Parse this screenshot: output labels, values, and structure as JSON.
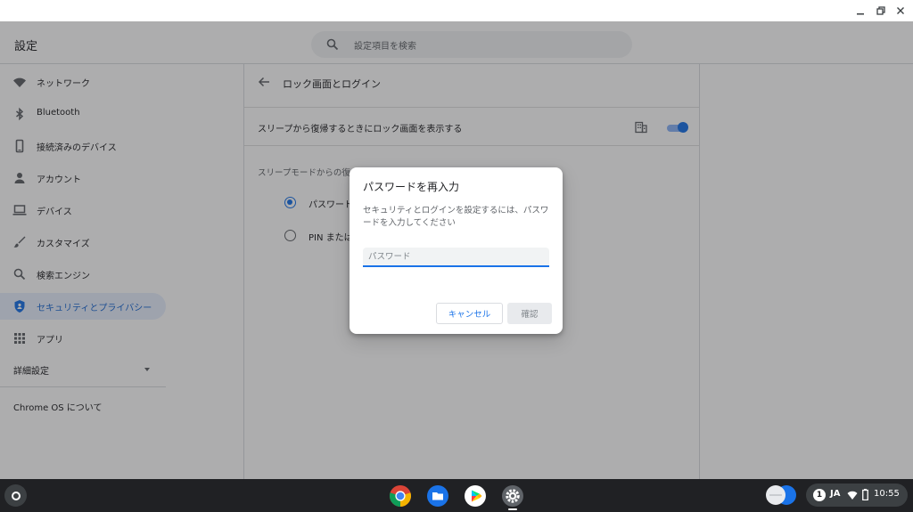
{
  "window": {
    "min_icon": "minimize-icon",
    "max_icon": "restore-icon",
    "close_icon": "close-icon"
  },
  "header": {
    "title": "設定",
    "search_placeholder": "設定項目を検索"
  },
  "sidebar": {
    "items": [
      {
        "label": "ネットワーク",
        "icon": "wifi-icon"
      },
      {
        "label": "Bluetooth",
        "icon": "bluetooth-icon"
      },
      {
        "label": "接続済みのデバイス",
        "icon": "phone-icon"
      },
      {
        "label": "アカウント",
        "icon": "person-icon"
      },
      {
        "label": "デバイス",
        "icon": "laptop-icon"
      },
      {
        "label": "カスタマイズ",
        "icon": "brush-icon"
      },
      {
        "label": "検索エンジン",
        "icon": "search-icon"
      },
      {
        "label": "セキュリティとプライバシー",
        "icon": "shield-icon",
        "active": true
      },
      {
        "label": "アプリ",
        "icon": "apps-grid-icon"
      }
    ],
    "advanced": "詳細設定",
    "about": "Chrome OS について"
  },
  "content": {
    "page_title": "ロック画面とログイン",
    "lock_row_label": "スリープから復帰するときにロック画面を表示する",
    "lock_toggle_on": true,
    "section_label": "スリープモードからの復",
    "options": [
      {
        "label": "パスワード",
        "checked": true
      },
      {
        "label": "PIN または",
        "checked": false
      }
    ]
  },
  "dialog": {
    "title": "パスワードを再入力",
    "body": "セキュリティとログインを設定するには、パスワードを入力してください",
    "password_placeholder": "パスワード",
    "cancel": "キャンセル",
    "confirm": "確認"
  },
  "shelf": {
    "apps": [
      "chrome-icon",
      "files-icon",
      "play-store-icon",
      "settings-icon"
    ],
    "notification_count": "1",
    "ime": "JA",
    "time": "10:55"
  },
  "colors": {
    "accent": "#1a73e8",
    "active_bg": "#e8f0fe",
    "shelf": "#202124"
  }
}
